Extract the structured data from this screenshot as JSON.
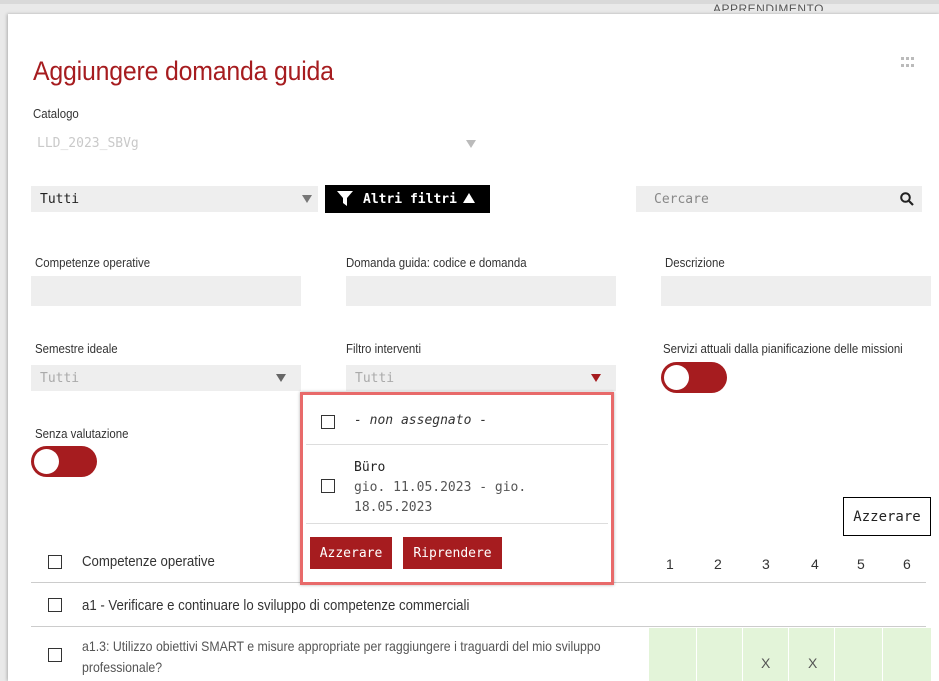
{
  "background_header": "APPRENDIMENTO",
  "dialog": {
    "title": "Aggiungere domanda guida"
  },
  "catalog": {
    "label": "Catalogo",
    "value": "LLD_2023_SBVg"
  },
  "filter_bar": {
    "scope_select": "Tutti",
    "more_filters_label": "Altri filtri",
    "search_placeholder": "Cercare"
  },
  "filters": {
    "competenze_label": "Competenze operative",
    "domanda_label": "Domanda guida: codice e domanda",
    "descrizione_label": "Descrizione",
    "semestre_label": "Semestre ideale",
    "semestre_value": "Tutti",
    "interventi_label": "Filtro interventi",
    "interventi_value": "Tutti",
    "servizi_label": "Servizi attuali dalla pianificazione delle missioni",
    "senza_label": "Senza valutazione",
    "reset_label": "Azzerare"
  },
  "dropdown": {
    "opt_unassigned": "- non assegnato -",
    "opt_office_name": "Büro",
    "opt_office_dates_1": "gio. 11.05.2023 - gio.",
    "opt_office_dates_2": "18.05.2023",
    "reset_label": "Azzerare",
    "apply_label": "Riprendere"
  },
  "table": {
    "header_label": "Competenze operative",
    "columns": [
      "1",
      "2",
      "3",
      "4",
      "5",
      "6"
    ],
    "row_a1": "a1 - Verificare e continuare lo sviluppo di competenze commerciali",
    "row_a13_line1": "a1.3: Utilizzo obiettivi SMART e misure appropriate per raggiungere i traguardi del mio sviluppo",
    "row_a13_line2": "professionale?",
    "row_a13_marks": [
      "",
      "",
      "X",
      "X",
      "",
      ""
    ]
  },
  "colors": {
    "accent": "#a61c1f",
    "highlight_border": "#e86a6a",
    "cell_green": "#e3f4d9"
  }
}
